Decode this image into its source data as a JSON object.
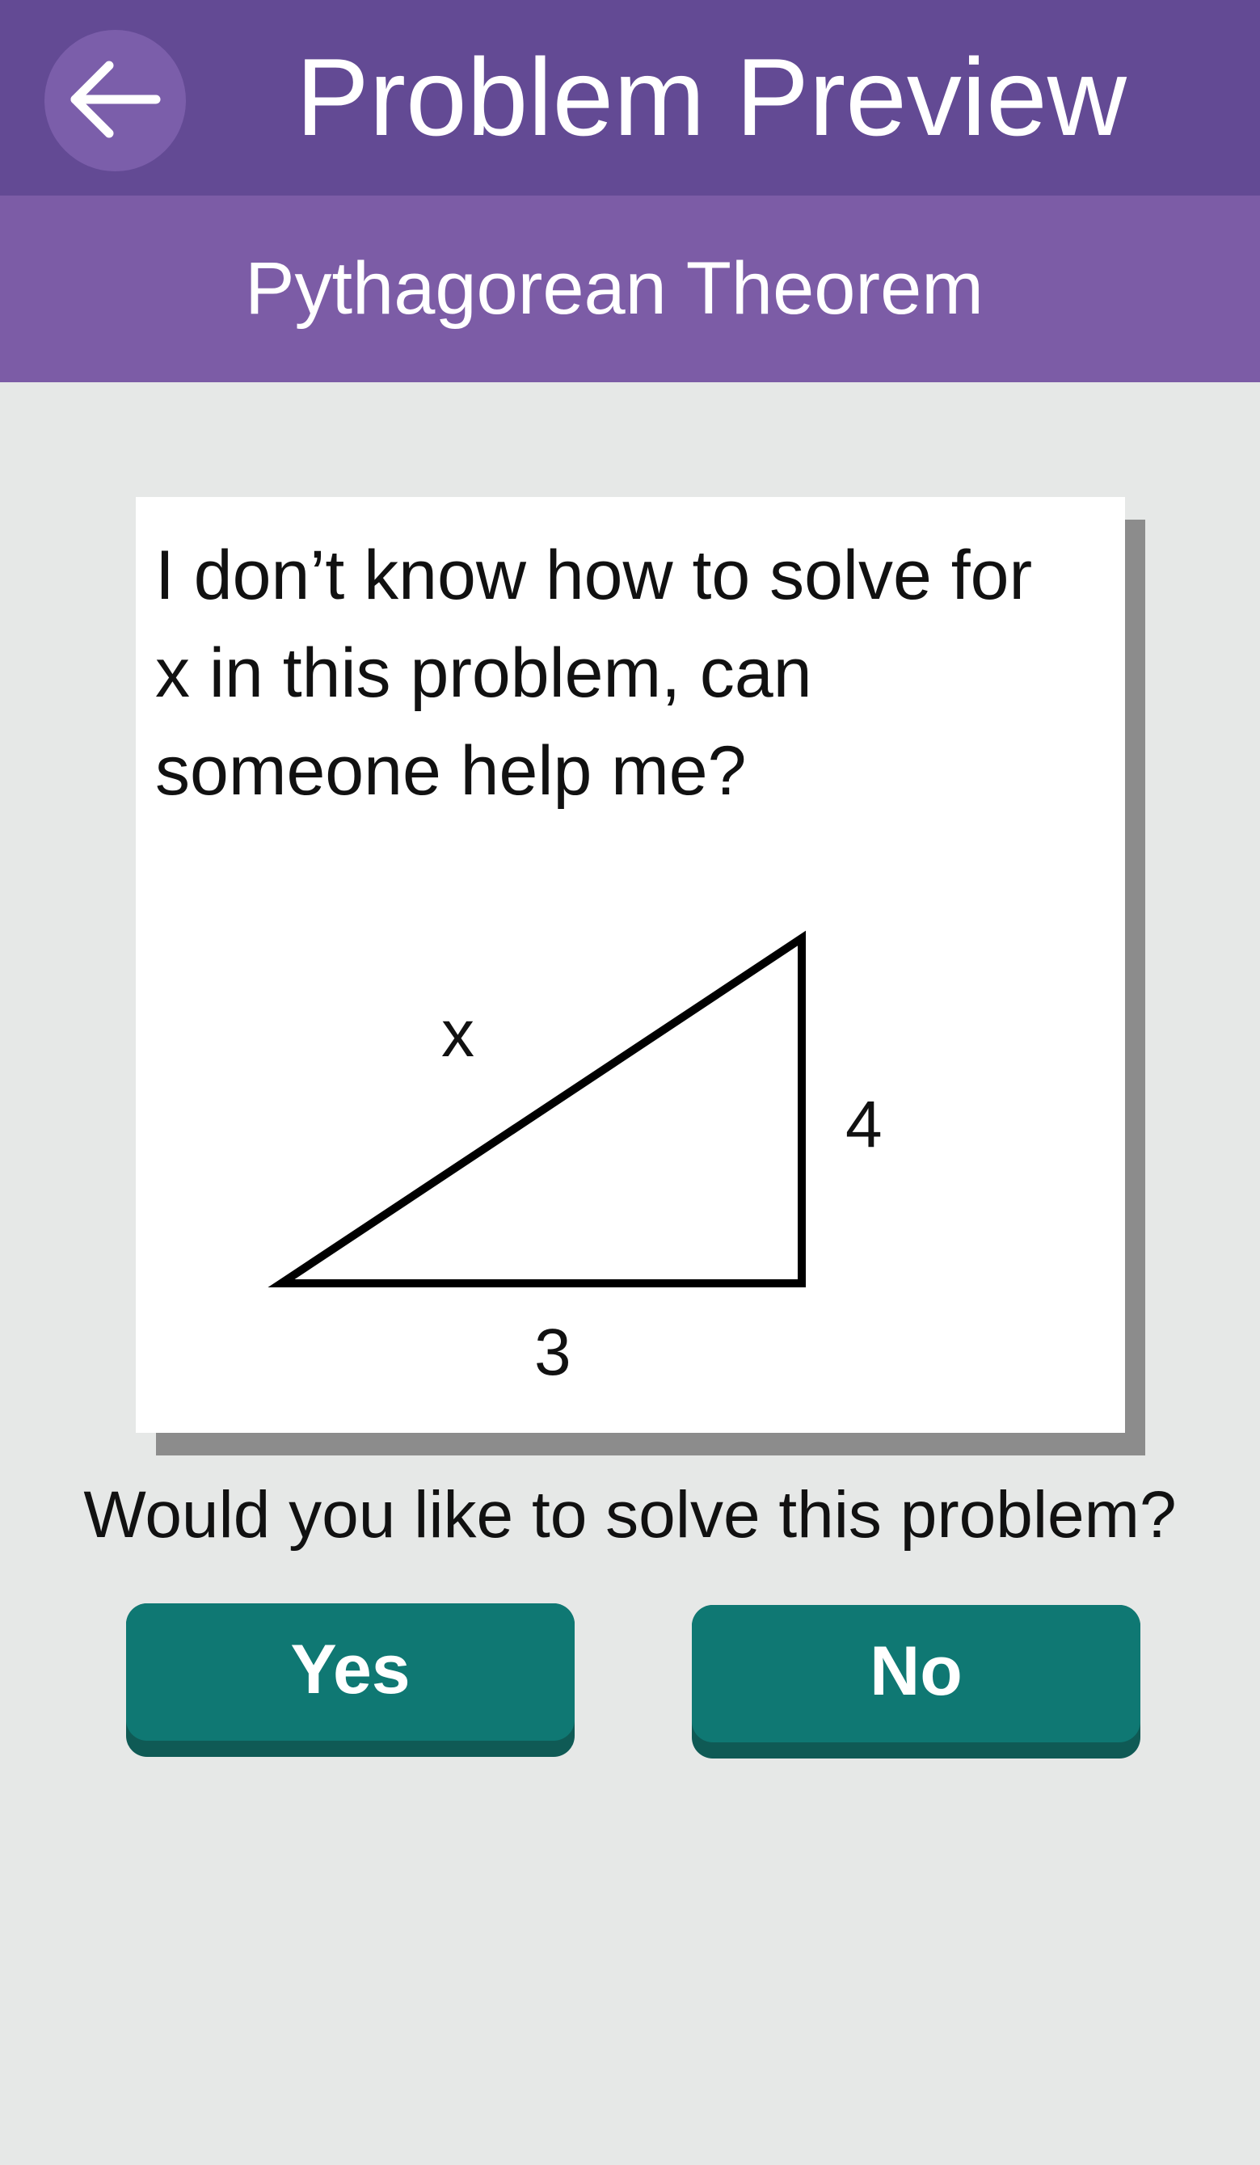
{
  "header": {
    "title": "Problem Preview",
    "back_icon": "arrow-left-icon"
  },
  "subheader": {
    "topic": "Pythagorean Theorem"
  },
  "problem": {
    "question": "I don’t know how to solve for x in this problem, can someone help me?",
    "figure": {
      "hypotenuse_label": "x",
      "vertical_side_label": "4",
      "horizontal_side_label": "3"
    }
  },
  "prompt": "Would you like to solve this problem?",
  "actions": {
    "yes_label": "Yes",
    "no_label": "No"
  },
  "colors": {
    "header_bg": "#634a94",
    "subheader_bg": "#7c5ca6",
    "page_bg": "#e6e8e7",
    "button_bg": "#0f7873"
  }
}
